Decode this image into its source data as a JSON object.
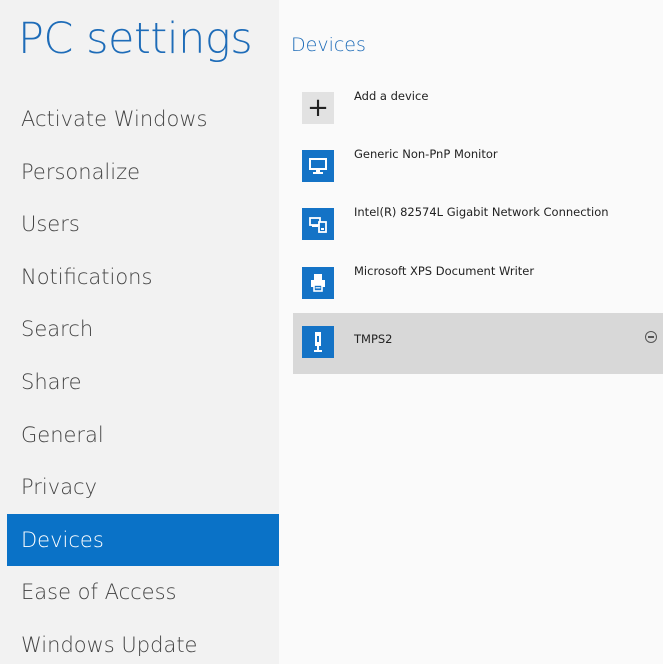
{
  "app": {
    "title": "PC settings"
  },
  "nav": {
    "items": [
      {
        "label": "Activate Windows"
      },
      {
        "label": "Personalize"
      },
      {
        "label": "Users"
      },
      {
        "label": "Notifications"
      },
      {
        "label": "Search"
      },
      {
        "label": "Share"
      },
      {
        "label": "General"
      },
      {
        "label": "Privacy"
      },
      {
        "label": "Devices",
        "selected": true
      },
      {
        "label": "Ease of Access"
      },
      {
        "label": "Windows Update"
      }
    ]
  },
  "main": {
    "section_title": "Devices",
    "add_device": {
      "label": "Add a device",
      "icon": "plus-icon"
    },
    "devices": [
      {
        "label": "Generic Non-PnP Monitor",
        "icon": "monitor-icon"
      },
      {
        "label": "Intel(R) 82574L Gigabit Network Connection",
        "icon": "network-adapter-icon"
      },
      {
        "label": "Microsoft XPS Document Writer",
        "icon": "printer-icon"
      },
      {
        "label": "TMPS2",
        "icon": "usb-device-icon",
        "selected": true,
        "remove_icon": "remove-icon"
      }
    ]
  },
  "colors": {
    "accent": "#0a72c7",
    "title": "#1e6cb8",
    "tile": "#1473c6",
    "selected_row": "#d8d8d8"
  }
}
